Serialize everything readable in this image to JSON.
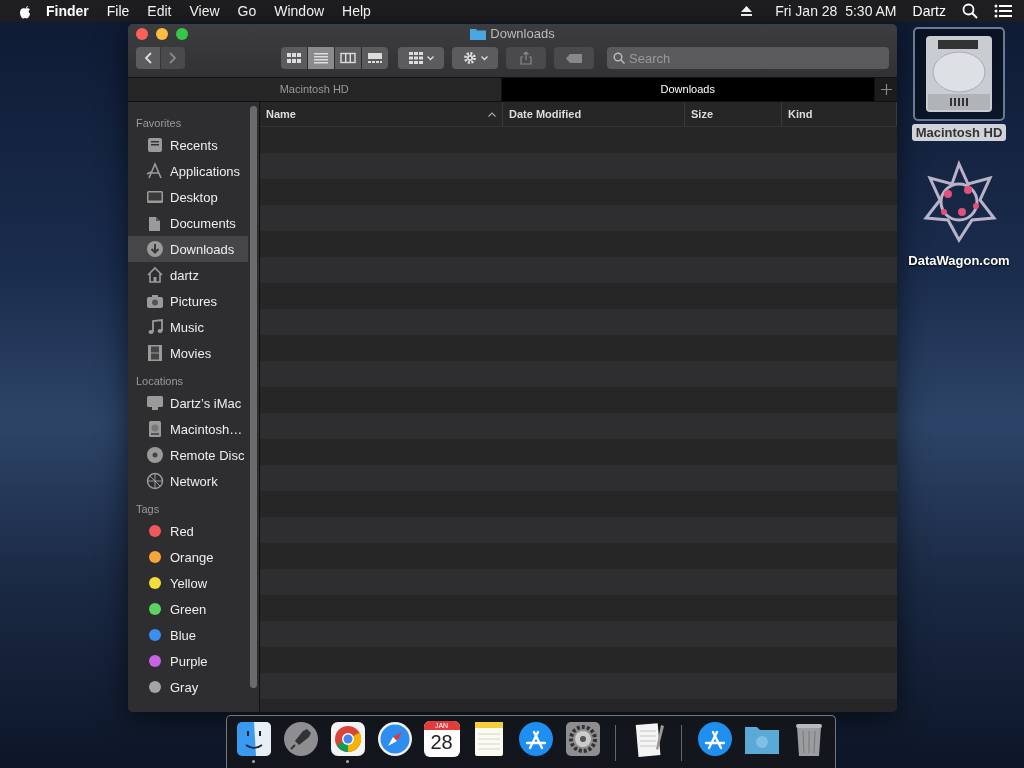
{
  "menubar": {
    "app_name": "Finder",
    "menus": [
      "File",
      "Edit",
      "View",
      "Go",
      "Window",
      "Help"
    ],
    "clock": "Fri Jan 28  5:30 AM",
    "user": "Dartz"
  },
  "window": {
    "title": "Downloads",
    "toolbar": {
      "view_modes": [
        {
          "kind": "icons",
          "selected": false
        },
        {
          "kind": "list",
          "selected": true
        },
        {
          "kind": "columns",
          "selected": false
        },
        {
          "kind": "gallery",
          "selected": false
        }
      ],
      "search": {
        "placeholder": "Search"
      }
    },
    "tabs": [
      {
        "label": "Macintosh HD",
        "selected": false
      },
      {
        "label": "Downloads",
        "selected": true
      }
    ],
    "sidebar": {
      "sections": [
        {
          "heading": "Favorites",
          "items": [
            {
              "label": "Recents",
              "kind": "recents",
              "selected": false
            },
            {
              "label": "Applications",
              "kind": "applications",
              "selected": false
            },
            {
              "label": "Desktop",
              "kind": "desktop",
              "selected": false
            },
            {
              "label": "Documents",
              "kind": "documents",
              "selected": false
            },
            {
              "label": "Downloads",
              "kind": "downloads",
              "selected": true
            },
            {
              "label": "dartz",
              "kind": "home",
              "selected": false
            },
            {
              "label": "Pictures",
              "kind": "pictures",
              "selected": false
            },
            {
              "label": "Music",
              "kind": "music",
              "selected": false
            },
            {
              "label": "Movies",
              "kind": "movies",
              "selected": false
            }
          ]
        },
        {
          "heading": "Locations",
          "items": [
            {
              "label": "Dartz’s iMac",
              "kind": "computer",
              "selected": false
            },
            {
              "label": "Macintosh…",
              "kind": "disk",
              "selected": false
            },
            {
              "label": "Remote Disc",
              "kind": "disc",
              "selected": false
            },
            {
              "label": "Network",
              "kind": "network",
              "selected": false
            }
          ]
        },
        {
          "heading": "Tags",
          "items": [
            {
              "label": "Red",
              "kind": "tag",
              "color": "#f0575c",
              "selected": false
            },
            {
              "label": "Orange",
              "kind": "tag",
              "color": "#f5a63a",
              "selected": false
            },
            {
              "label": "Yellow",
              "kind": "tag",
              "color": "#f4dc3a",
              "selected": false
            },
            {
              "label": "Green",
              "kind": "tag",
              "color": "#5bd462",
              "selected": false
            },
            {
              "label": "Blue",
              "kind": "tag",
              "color": "#3c8ef3",
              "selected": false
            },
            {
              "label": "Purple",
              "kind": "tag",
              "color": "#c664e3",
              "selected": false
            },
            {
              "label": "Gray",
              "kind": "tag",
              "color": "#a4a4a8",
              "selected": false
            }
          ]
        }
      ]
    },
    "table": {
      "columns": [
        {
          "label": "Name",
          "sorted": true
        },
        {
          "label": "Date Modified",
          "sorted": false
        },
        {
          "label": "Size",
          "sorted": false
        },
        {
          "label": "Kind",
          "sorted": false
        }
      ]
    }
  },
  "desktop_icons": [
    {
      "label": "Macintosh HD",
      "kind": "disk",
      "selected": true
    },
    {
      "label": "DataWagon.com",
      "kind": "star",
      "selected": false
    }
  ],
  "dock": {
    "items": [
      {
        "kind": "finder",
        "running": true
      },
      {
        "kind": "launchpad",
        "running": false
      },
      {
        "kind": "chrome",
        "running": true
      },
      {
        "kind": "safari",
        "running": false
      },
      {
        "kind": "calendar",
        "running": false,
        "month": "JAN",
        "day": "28"
      },
      {
        "kind": "notes",
        "running": false
      },
      {
        "kind": "appstore",
        "running": false
      },
      {
        "kind": "settings",
        "running": false
      },
      {
        "kind": "separator"
      },
      {
        "kind": "textedit",
        "running": false
      },
      {
        "kind": "separator"
      },
      {
        "kind": "appstore",
        "running": false
      },
      {
        "kind": "folder",
        "running": false
      },
      {
        "kind": "trash",
        "running": false
      }
    ]
  }
}
